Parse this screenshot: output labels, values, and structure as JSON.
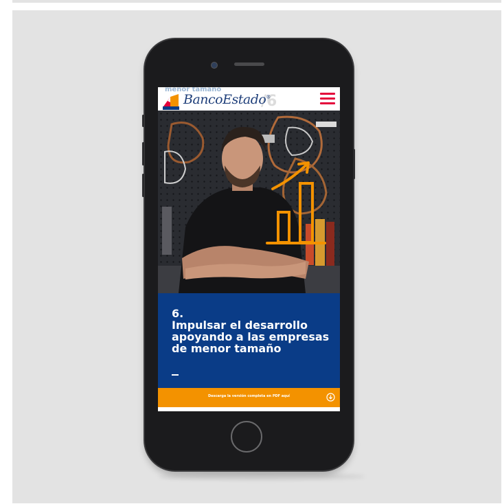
{
  "header": {
    "ghost_text": "menor tamaño",
    "brand": "BancoEstado",
    "brand_mark": "®",
    "faded_text": "/6"
  },
  "section": {
    "number": "6.",
    "title": "Impulsar el desarrollo apoyando a las empresas de menor tamaño",
    "dash": "–"
  },
  "footer_bar": {
    "label": "Descarga la versión completa en PDF aquí"
  },
  "icons": {
    "menu": "hamburger-menu-icon",
    "download": "download-circle-icon",
    "growth": "growth-chart-icon",
    "logo": "bancoestado-logo-icon"
  },
  "colors": {
    "brand_blue": "#0a3c87",
    "accent_orange": "#f39200",
    "menu_red": "#e4003a",
    "background": "#e3e3e3"
  }
}
